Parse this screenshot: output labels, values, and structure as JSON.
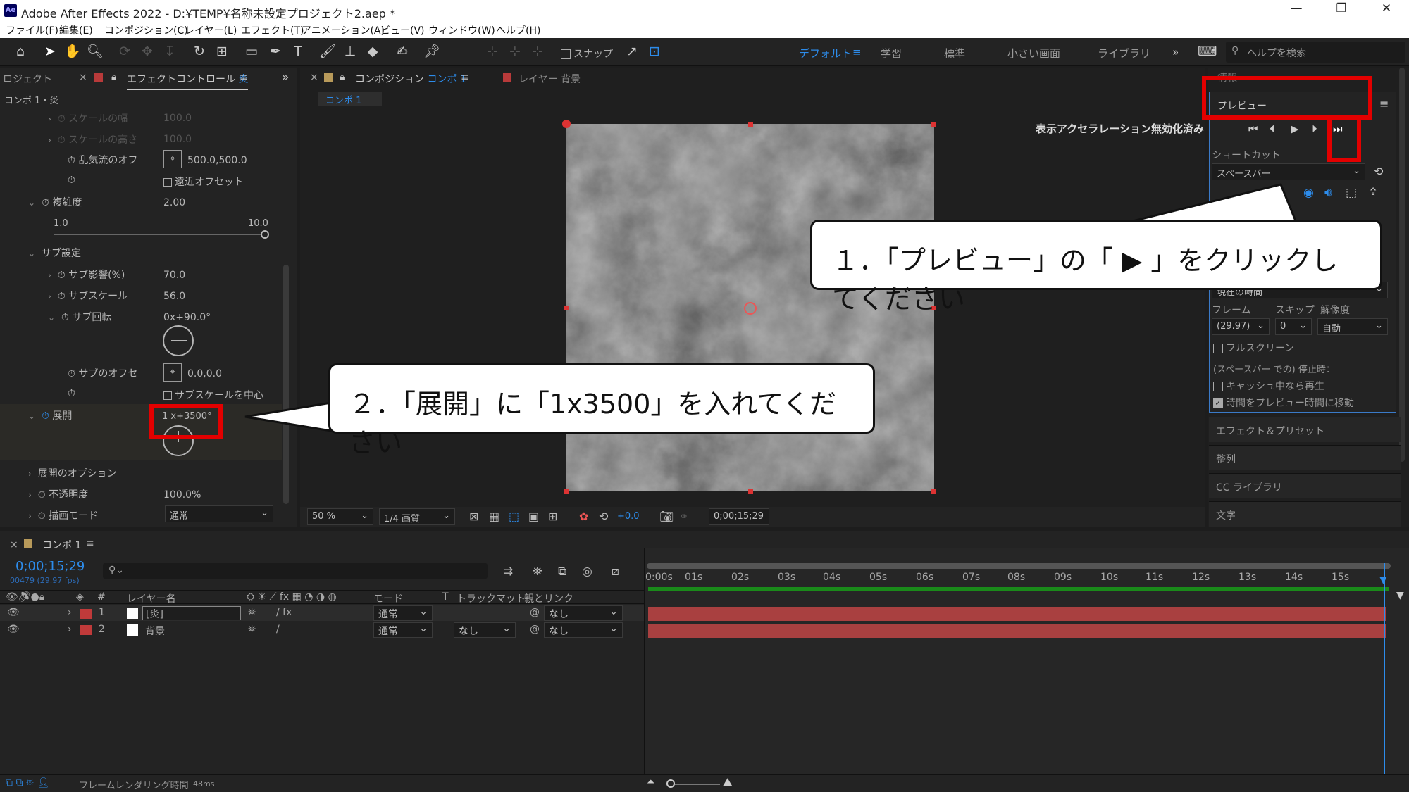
{
  "window": {
    "title": "Adobe After Effects 2022 - D:¥TEMP¥名称未設定プロジェクト2.aep *",
    "logo": "Ae"
  },
  "menu": [
    "ファイル(F)",
    "編集(E)",
    "コンポジション(C)",
    "レイヤー(L)",
    "エフェクト(T)",
    "アニメーション(A)",
    "ビュー(V)",
    "ウィンドウ(W)",
    "ヘルプ(H)"
  ],
  "toolbar": {
    "snap_label": "スナップ",
    "workspaces": [
      "デフォルト",
      "学習",
      "標準",
      "小さい画面",
      "ライブラリ"
    ],
    "help_search": "ヘルプを検索",
    "more": "»"
  },
  "left_panel": {
    "tab_project": "ロジェクト",
    "tab_effect": "エフェクトコントロール",
    "tab_effect_layer": "炎",
    "breadcrumb": "コンポ 1・炎",
    "props": {
      "scale_w": "スケールの幅",
      "scale_w_val": "100.0",
      "scale_h": "スケールの高さ",
      "scale_h_val": "100.0",
      "turb_offset": "乱気流のオフ",
      "turb_offset_val": "500.0,500.0",
      "perspective": "遠近オフセット",
      "complexity": "複雑度",
      "complexity_val": "2.00",
      "slider_min": "1.0",
      "slider_max": "10.0",
      "sub_settings": "サブ設定",
      "sub_influence": "サブ影響(%)",
      "sub_influence_val": "70.0",
      "sub_scale": "サブスケール",
      "sub_scale_val": "56.0",
      "sub_rotation": "サブ回転",
      "sub_rotation_val": "0x+90.0°",
      "sub_offset": "サブのオフセ",
      "sub_offset_val": "0.0,0.0",
      "center_sub": "サブスケールを中心",
      "evolution": "展開",
      "evolution_val": "1 x+3500°",
      "evolution_options": "展開のオプション",
      "opacity": "不透明度",
      "opacity_val": "100.0%",
      "blend_mode": "描画モード",
      "blend_mode_val": "通常"
    }
  },
  "comp_panel": {
    "tab_label": "コンポジション",
    "tab_name": "コンポ 1",
    "layer_tab": "レイヤー 背景",
    "sub_tab": "コンポ 1",
    "notice": "表示アクセラレーション無効化済み",
    "zoom": "50 %",
    "quality": "1/4 画質",
    "exposure": "+0.0",
    "timecode": "0;00;15;29"
  },
  "right_panel": {
    "info_tab": "情報",
    "preview_title": "プレビュー",
    "shortcut_label": "ショートカット",
    "shortcut_val": "スペースバー",
    "current_time": "現在の時間",
    "frame_label": "フレーム",
    "skip_label": "スキップ",
    "resolution_label": "解像度",
    "frame_val": "(29.97)",
    "skip_val": "0",
    "resolution_val": "自動",
    "fullscreen": "フルスクリーン",
    "stop_label": "(スペースバー での) 停止時：",
    "cache_play": "キャッシュ中なら再生",
    "move_time": "時間をプレビュー時間に移動",
    "items": [
      "エフェクト＆プリセット",
      "整列",
      "CC ライブラリ",
      "文字"
    ]
  },
  "timeline": {
    "tab": "コンポ 1",
    "timecode": "0;00;15;29",
    "fps": "00479 (29.97 fps)",
    "cols": {
      "layer_name": "レイヤー名",
      "mode": "モード",
      "t": "T",
      "track_matte": "トラックマット",
      "parent": "親とリンク"
    },
    "layers": [
      {
        "num": "1",
        "name": "[炎]",
        "mode": "通常",
        "matte": "",
        "parent": "なし"
      },
      {
        "num": "2",
        "name": "背景",
        "mode": "通常",
        "matte": "なし",
        "parent": "なし"
      }
    ],
    "ticks": [
      "0:00s",
      "01s",
      "02s",
      "03s",
      "04s",
      "05s",
      "06s",
      "07s",
      "08s",
      "09s",
      "10s",
      "11s",
      "12s",
      "13s",
      "14s",
      "15s"
    ],
    "render_label": "フレームレンダリング時間",
    "render_val": "48ms"
  },
  "callouts": {
    "one": "１．「プレビュー」の「 ▶ 」をクリックしてください",
    "two": "２．「展開」に「1x3500」を入れてください"
  },
  "colors": {
    "accent_blue": "#2d8ceb",
    "highlight_red": "#e30000",
    "layer_red": "#b83a3a"
  }
}
